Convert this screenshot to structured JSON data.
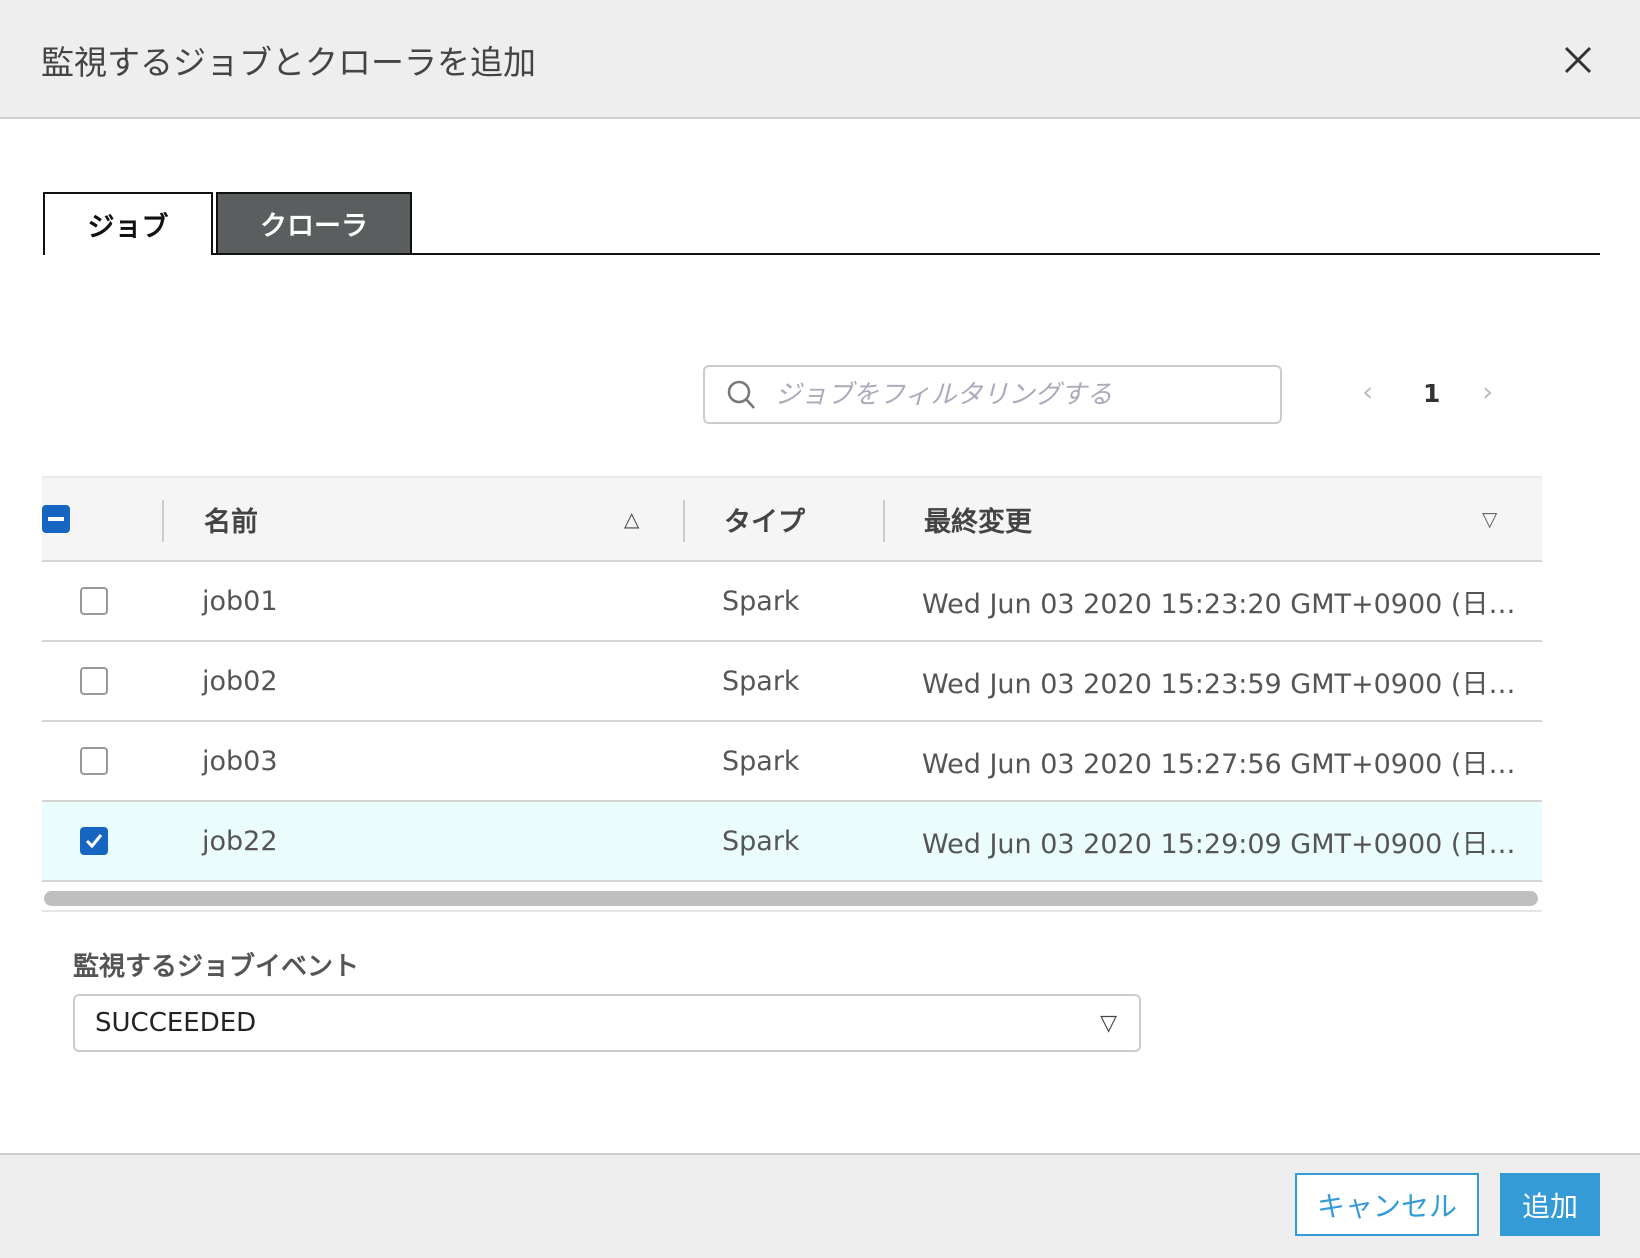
{
  "dialog": {
    "title": "監視するジョブとクローラを追加"
  },
  "tabs": [
    {
      "label": "ジョブ",
      "active": true
    },
    {
      "label": "クローラ",
      "active": false
    }
  ],
  "search": {
    "placeholder": "ジョブをフィルタリングする",
    "value": ""
  },
  "pagination": {
    "page": "1"
  },
  "table": {
    "columns": [
      "名前",
      "タイプ",
      "最終変更"
    ],
    "rows": [
      {
        "name": "job01",
        "type": "Spark",
        "modified": "Wed Jun 03 2020 15:23:20 GMT+0900 (日…",
        "checked": false
      },
      {
        "name": "job02",
        "type": "Spark",
        "modified": "Wed Jun 03 2020 15:23:59 GMT+0900 (日…",
        "checked": false
      },
      {
        "name": "job03",
        "type": "Spark",
        "modified": "Wed Jun 03 2020 15:27:56 GMT+0900 (日…",
        "checked": false
      },
      {
        "name": "job22",
        "type": "Spark",
        "modified": "Wed Jun 03 2020 15:29:09 GMT+0900 (日…",
        "checked": true
      }
    ]
  },
  "event": {
    "label": "監視するジョブイベント",
    "value": "SUCCEEDED"
  },
  "footer": {
    "cancel": "キャンセル",
    "add": "追加"
  },
  "colors": {
    "accent": "#359bd6",
    "checkbox": "#1666c1",
    "selected_row": "#ebfcfd"
  }
}
